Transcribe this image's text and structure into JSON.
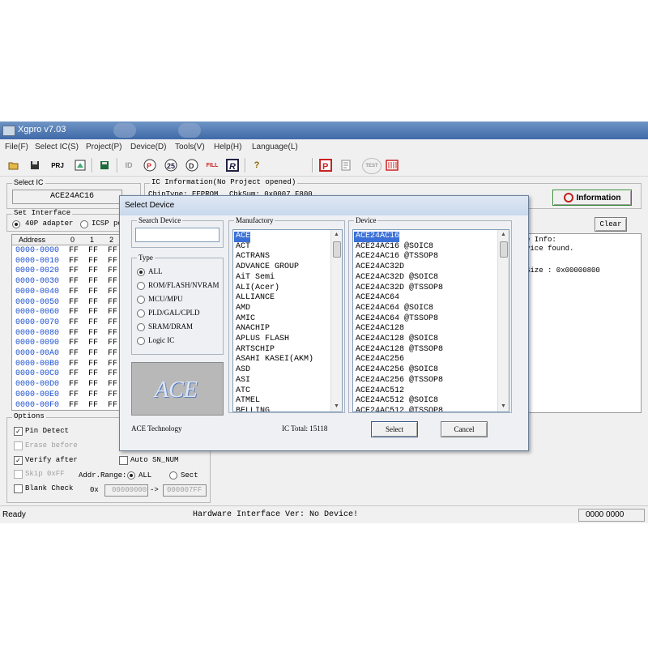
{
  "window": {
    "title": "Xgpro v7.03"
  },
  "menu": [
    "File(F)",
    "Select IC(S)",
    "Project(P)",
    "Device(D)",
    "Tools(V)",
    "Help(H)",
    "Language(L)"
  ],
  "toolbar": {
    "prj_label": "PRJ",
    "fill_label": "FILL",
    "test_label": "TEST"
  },
  "select_ic": {
    "label": "Select IC",
    "value": "ACE24AC16"
  },
  "ic_info": {
    "label": "IC Information(No Project opened)",
    "chip_type": "ChipType:  EEPROM",
    "chksum": "ChkSum: 0x0007 F800"
  },
  "info_button": "Information",
  "clear_button": "Clear",
  "log": {
    "line1": "e Info:",
    "line2": "vice found.",
    "line3": "Size : 0x00000800"
  },
  "interface": {
    "label": "Set Interface",
    "opt1": "40P adapter",
    "opt2": "ICSP po"
  },
  "hex": {
    "headers": [
      "Address",
      "0",
      "1",
      "2"
    ],
    "rows": [
      {
        "addr": "0000-0000",
        "v": [
          "FF",
          "FF",
          "FF"
        ]
      },
      {
        "addr": "0000-0010",
        "v": [
          "FF",
          "FF",
          "FF"
        ]
      },
      {
        "addr": "0000-0020",
        "v": [
          "FF",
          "FF",
          "FF"
        ]
      },
      {
        "addr": "0000-0030",
        "v": [
          "FF",
          "FF",
          "FF"
        ]
      },
      {
        "addr": "0000-0040",
        "v": [
          "FF",
          "FF",
          "FF"
        ]
      },
      {
        "addr": "0000-0050",
        "v": [
          "FF",
          "FF",
          "FF"
        ]
      },
      {
        "addr": "0000-0060",
        "v": [
          "FF",
          "FF",
          "FF"
        ]
      },
      {
        "addr": "0000-0070",
        "v": [
          "FF",
          "FF",
          "FF"
        ]
      },
      {
        "addr": "0000-0080",
        "v": [
          "FF",
          "FF",
          "FF"
        ]
      },
      {
        "addr": "0000-0090",
        "v": [
          "FF",
          "FF",
          "FF"
        ]
      },
      {
        "addr": "0000-00A0",
        "v": [
          "FF",
          "FF",
          "FF"
        ]
      },
      {
        "addr": "0000-00B0",
        "v": [
          "FF",
          "FF",
          "FF"
        ]
      },
      {
        "addr": "0000-00C0",
        "v": [
          "FF",
          "FF",
          "FF"
        ]
      },
      {
        "addr": "0000-00D0",
        "v": [
          "FF",
          "FF",
          "FF"
        ]
      },
      {
        "addr": "0000-00E0",
        "v": [
          "FF",
          "FF",
          "FF"
        ]
      },
      {
        "addr": "0000-00F0",
        "v": [
          "FF",
          "FF",
          "FF"
        ]
      }
    ]
  },
  "options": {
    "label": "Options",
    "pin_detect": "Pin Detect",
    "erase_before": "Erase before",
    "verify_after": "Verify after",
    "auto_sn": "Auto SN_NUM",
    "skip_off": "Skip 0xFF",
    "addr_range": "Addr.Range:",
    "all": "ALL",
    "sect": "Sect",
    "blank_check": "Blank Check",
    "ox": "0x",
    "from": "00000000",
    "arrow": "->",
    "to": "000007FF"
  },
  "dialog": {
    "title": "Select Device",
    "search_label": "Search Device",
    "search_value": "",
    "type_label": "Type",
    "types": [
      "ALL",
      "ROM/FLASH/NVRAM",
      "MCU/MPU",
      "PLD/GAL/CPLD",
      "SRAM/DRAM",
      "Logic IC"
    ],
    "logo_text": "ACE",
    "manufacturer_name": "ACE Technology",
    "ic_total": "IC Total:  15118",
    "manufactory_label": "Manufactory",
    "manufactory": [
      "ACE",
      "ACT",
      "ACTRANS",
      "ADVANCE GROUP",
      "AiT Semi",
      "ALI(Acer)",
      "ALLIANCE",
      "AMD",
      "AMIC",
      "ANACHIP",
      "APLUS FLASH",
      "ARTSCHIP",
      "ASAHI KASEI(AKM)",
      "ASD",
      "ASI",
      "ATC",
      "ATMEL",
      "BELLING"
    ],
    "device_label": "Device",
    "devices": [
      "ACE24AC16",
      "ACE24AC16 @SOIC8",
      "ACE24AC16 @TSSOP8",
      "ACE24AC32D",
      "ACE24AC32D @SOIC8",
      "ACE24AC32D @TSSOP8",
      "ACE24AC64",
      "ACE24AC64 @SOIC8",
      "ACE24AC64 @TSSOP8",
      "ACE24AC128",
      "ACE24AC128 @SOIC8",
      "ACE24AC128 @TSSOP8",
      "ACE24AC256",
      "ACE24AC256 @SOIC8",
      "ACE24AC256 @TSSOP8",
      "ACE24AC512",
      "ACE24AC512 @SOIC8",
      "ACE24AC512 @TSSOP8"
    ],
    "select_button": "Select",
    "cancel_button": "Cancel"
  },
  "status": {
    "ready": "Ready",
    "hw": "Hardware Interface Ver: No Device!",
    "code": "0000 0000"
  },
  "colors": {
    "title_bar": "#3f6aa8",
    "selection": "#3a6fd8",
    "address_blue": "#1a4fd0",
    "info_red": "#c0201a",
    "info_green": "#2f8a2f"
  }
}
